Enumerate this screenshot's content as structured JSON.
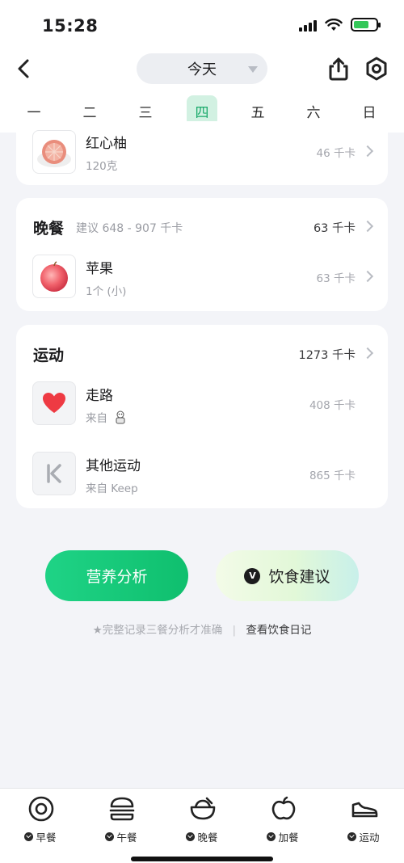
{
  "status_bar": {
    "time": "15:28"
  },
  "nav": {
    "date_label": "今天"
  },
  "weekdays": [
    {
      "label": "一",
      "active": false
    },
    {
      "label": "二",
      "active": false
    },
    {
      "label": "三",
      "active": false
    },
    {
      "label": "四",
      "active": true
    },
    {
      "label": "五",
      "active": false
    },
    {
      "label": "六",
      "active": false
    },
    {
      "label": "日",
      "active": false
    }
  ],
  "snack_partial": {
    "item": {
      "name": "红心柚",
      "amount": "120克",
      "kcal": "46 千卡"
    }
  },
  "dinner": {
    "title": "晚餐",
    "suggestion": "建议 648 - 907 千卡",
    "total": "63 千卡",
    "item": {
      "name": "苹果",
      "amount": "1个 (小)",
      "kcal": "63 千卡"
    }
  },
  "exercise": {
    "title": "运动",
    "total": "1273 千卡",
    "items": [
      {
        "name": "走路",
        "source": "来自",
        "kcal": "408 千卡",
        "icon": "heart-icon"
      },
      {
        "name": "其他运动",
        "source": "来自 Keep",
        "kcal": "865 千卡",
        "icon": "keep-logo-icon"
      }
    ]
  },
  "actions": {
    "nutrition_label": "营养分析",
    "diet_label": "饮食建议",
    "vip_mark": "V"
  },
  "tip": {
    "text": "★完整记录三餐分析才准确",
    "separator": "|",
    "link": "查看饮食日记"
  },
  "tabbar": [
    {
      "label": "早餐",
      "icon": "fried-egg-icon"
    },
    {
      "label": "午餐",
      "icon": "burger-icon"
    },
    {
      "label": "晚餐",
      "icon": "rice-bowl-icon"
    },
    {
      "label": "加餐",
      "icon": "apple-icon"
    },
    {
      "label": "运动",
      "icon": "sneaker-icon"
    }
  ],
  "colors": {
    "accent_green": "#19a96a",
    "active_day_bg": "#d2f1e2",
    "background": "#f3f4f8"
  }
}
